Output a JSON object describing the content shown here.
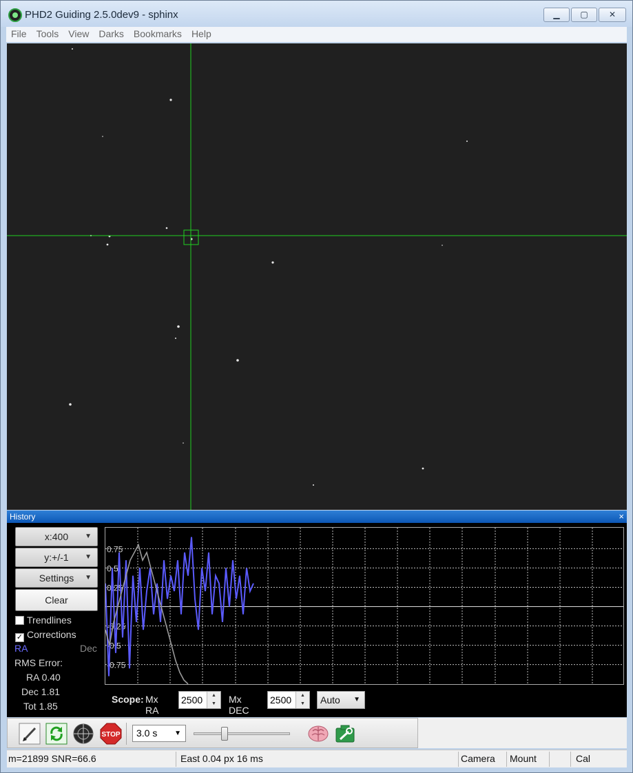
{
  "window": {
    "title": "PHD2 Guiding 2.5.0dev9 - sphinx"
  },
  "menu": [
    "File",
    "Tools",
    "View",
    "Darks",
    "Bookmarks",
    "Help"
  ],
  "history": {
    "title": "History",
    "close_label": "×",
    "x_scale": "x:400",
    "y_scale": "y:+/-1",
    "settings_label": "Settings",
    "clear_label": "Clear",
    "trendlines_label": "Trendlines",
    "trendlines_checked": false,
    "corrections_label": "Corrections",
    "corrections_checked": true,
    "ra_label": "RA",
    "dec_label": "Dec",
    "rms_label": "RMS Error:",
    "rms_ra": "RA 0.40",
    "rms_dec": "Dec 1.81",
    "rms_tot": "Tot 1.85",
    "scope_label": "Scope:",
    "mx_ra_label": "Mx RA",
    "mx_ra_value": "2500",
    "mx_dec_label": "Mx DEC",
    "mx_dec_value": "2500",
    "dec_mode": "Auto",
    "colors": {
      "ra": "#5b5bff",
      "dec": "#9a9a9a"
    }
  },
  "chart_data": {
    "type": "line",
    "y_tick_labels": [
      "0.75",
      "0.5",
      "0.25",
      "-0.25",
      "-0.5",
      "-0.75"
    ],
    "ylim": [
      -1,
      1
    ],
    "grid": true,
    "series": [
      {
        "name": "RA",
        "values": [
          0.3,
          -0.9,
          0.5,
          -0.6,
          0.7,
          -0.4,
          0.6,
          -0.8,
          0.4,
          -0.2,
          0.5,
          -0.3,
          0.2,
          0.5,
          -0.1,
          0.3,
          -0.2,
          0.6,
          0.1,
          0.4,
          0.2,
          0.6,
          -0.1,
          0.7,
          0.4,
          0.9,
          0.1,
          -0.3,
          0.5,
          0.2,
          0.7,
          -0.1,
          0.4,
          0.3,
          -0.2,
          0.5,
          0.0,
          0.6,
          0.1,
          0.4,
          -0.1,
          0.5,
          0.2,
          0.3
        ]
      },
      {
        "name": "Dec",
        "values": [
          -0.3,
          -0.5,
          -0.2,
          0.0,
          0.2,
          0.4,
          0.6,
          0.7,
          0.8,
          0.6,
          0.7,
          0.5,
          0.3,
          0.1,
          -0.1,
          -0.3,
          -0.5,
          -0.7,
          -0.85,
          -0.95,
          -1.0
        ]
      }
    ]
  },
  "toolbar": {
    "exposure": "3.0 s",
    "stop_label": "STOP"
  },
  "status": {
    "star_info": "m=21899 SNR=66.6",
    "guide_info": "East  0.04 px  16 ms",
    "camera": "Camera",
    "mount": "Mount",
    "cal": "Cal"
  }
}
